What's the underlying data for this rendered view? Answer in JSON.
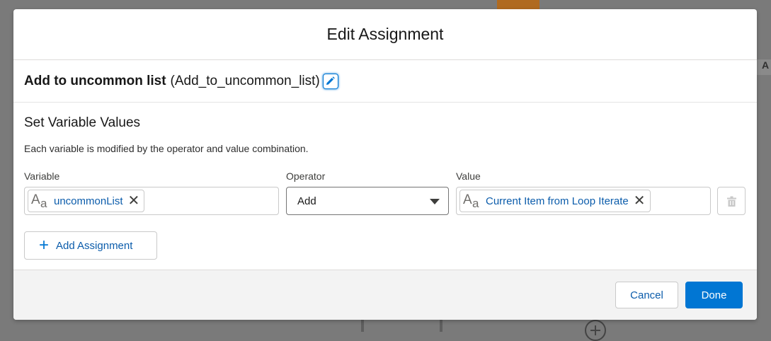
{
  "modal": {
    "title": "Edit Assignment"
  },
  "element": {
    "label": "Add to uncommon list",
    "api_name": "(Add_to_uncommon_list)",
    "edit_icon": "pencil-icon"
  },
  "section": {
    "title": "Set Variable Values",
    "description": "Each variable is modified by the operator and value combination."
  },
  "assignment_row": {
    "variable_label": "Variable",
    "variable_value": "uncommonList",
    "operator_label": "Operator",
    "operator_value": "Add",
    "value_label": "Value",
    "value_value": "Current Item from Loop Iterate",
    "text_type_icon": "text-type-icon",
    "remove_icon": "close-icon",
    "delete_icon": "trash-icon"
  },
  "add_assignment": {
    "label": "Add Assignment",
    "icon": "plus-icon"
  },
  "footer": {
    "cancel_label": "Cancel",
    "done_label": "Done"
  },
  "background": {
    "right_panel_text": "A"
  },
  "colors": {
    "brand": "#0176d3",
    "link": "#0b5cab",
    "overlay": "#7a7a7a"
  }
}
